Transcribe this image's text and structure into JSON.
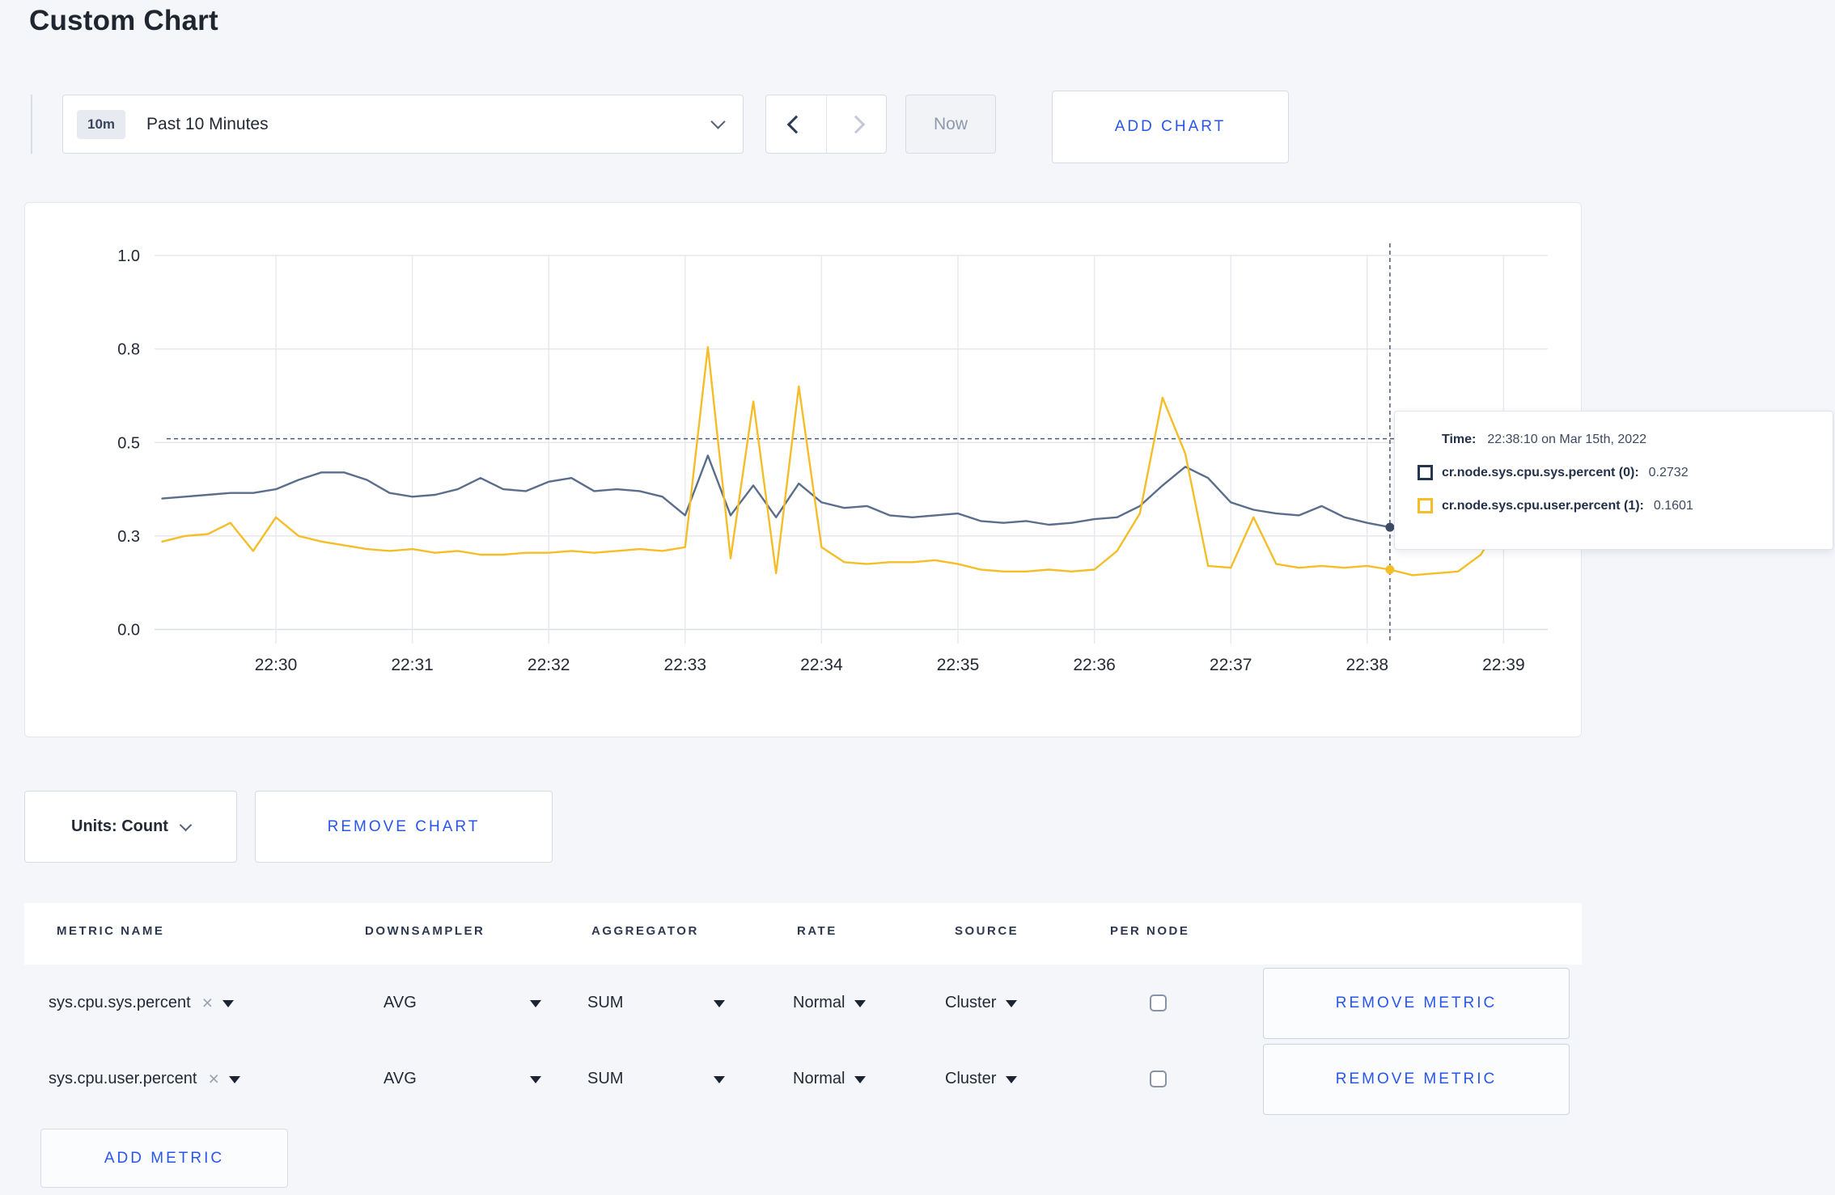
{
  "page": {
    "title": "Custom Chart",
    "background": "#f5f6fa",
    "accent_blue": "#2855EB"
  },
  "toolbar": {
    "time_window": {
      "badge": "10m",
      "label": "Past 10 Minutes"
    },
    "now_label": "Now",
    "add_chart_label": "ADD CHART"
  },
  "chart_data": {
    "type": "line",
    "title": "",
    "xlabel": "",
    "ylabel": "",
    "x_axis": {
      "tick_labels": [
        "22:30",
        "22:31",
        "22:32",
        "22:33",
        "22:34",
        "22:35",
        "22:36",
        "22:37",
        "22:38",
        "22:39"
      ],
      "start_time": "22:29:10",
      "interval_seconds": 10
    },
    "y_axis": {
      "range": [
        0,
        1
      ],
      "tick_values": [
        0,
        0.25,
        0.5,
        0.75,
        1.0
      ],
      "tick_labels": [
        "0.0",
        "0.3",
        "0.5",
        "0.8",
        "1.0"
      ]
    },
    "grid": true,
    "legend_position": "none",
    "series": [
      {
        "name": "cr.node.sys.cpu.sys.percent",
        "color": "#5A6E8C",
        "values": [
          0.35,
          0.355,
          0.36,
          0.365,
          0.365,
          0.375,
          0.4,
          0.42,
          0.42,
          0.4,
          0.365,
          0.355,
          0.36,
          0.375,
          0.405,
          0.375,
          0.37,
          0.395,
          0.405,
          0.37,
          0.375,
          0.37,
          0.355,
          0.305,
          0.465,
          0.305,
          0.385,
          0.3,
          0.39,
          0.34,
          0.325,
          0.33,
          0.305,
          0.3,
          0.305,
          0.31,
          0.29,
          0.285,
          0.29,
          0.28,
          0.285,
          0.295,
          0.3,
          0.33,
          0.385,
          0.435,
          0.405,
          0.34,
          0.32,
          0.31,
          0.305,
          0.33,
          0.3,
          0.285,
          0.2732,
          0.27,
          0.28,
          0.3,
          0.295,
          0.3,
          0.295,
          0.3
        ]
      },
      {
        "name": "cr.node.sys.cpu.user.percent",
        "color": "#F5BD27",
        "values": [
          0.235,
          0.25,
          0.255,
          0.285,
          0.21,
          0.3,
          0.25,
          0.235,
          0.225,
          0.215,
          0.21,
          0.215,
          0.205,
          0.21,
          0.2,
          0.2,
          0.205,
          0.205,
          0.21,
          0.205,
          0.21,
          0.215,
          0.21,
          0.22,
          0.755,
          0.19,
          0.61,
          0.15,
          0.65,
          0.22,
          0.18,
          0.175,
          0.18,
          0.18,
          0.185,
          0.175,
          0.16,
          0.155,
          0.155,
          0.16,
          0.155,
          0.16,
          0.21,
          0.31,
          0.62,
          0.47,
          0.17,
          0.165,
          0.3,
          0.175,
          0.165,
          0.17,
          0.165,
          0.17,
          0.1601,
          0.145,
          0.15,
          0.155,
          0.2,
          0.3,
          0.285,
          0.245
        ]
      }
    ],
    "hover": {
      "time_index": 54,
      "time_label": "22:38:10 on Mar 15th, 2022",
      "crosshair_value": 0.51
    }
  },
  "tooltip": {
    "time_label": "Time:",
    "time_value": "22:38:10 on Mar 15th, 2022",
    "entries": [
      {
        "label": "cr.node.sys.cpu.sys.percent (0):",
        "value": "0.2732",
        "color": "#253550"
      },
      {
        "label": "cr.node.sys.cpu.user.percent (1):",
        "value": "0.1601",
        "color": "#F5BD27"
      }
    ]
  },
  "chart_controls": {
    "units_label": "Units: Count",
    "remove_chart_label": "REMOVE CHART"
  },
  "metrics_table": {
    "headers": [
      "METRIC NAME",
      "DOWNSAMPLER",
      "AGGREGATOR",
      "RATE",
      "SOURCE",
      "PER NODE"
    ],
    "rows": [
      {
        "metric_name": "sys.cpu.sys.percent",
        "downsampler": "AVG",
        "aggregator": "SUM",
        "rate": "Normal",
        "source": "Cluster",
        "per_node_checked": false,
        "remove_label": "REMOVE METRIC"
      },
      {
        "metric_name": "sys.cpu.user.percent",
        "downsampler": "AVG",
        "aggregator": "SUM",
        "rate": "Normal",
        "source": "Cluster",
        "per_node_checked": false,
        "remove_label": "REMOVE METRIC"
      }
    ],
    "add_metric_label": "ADD METRIC"
  }
}
